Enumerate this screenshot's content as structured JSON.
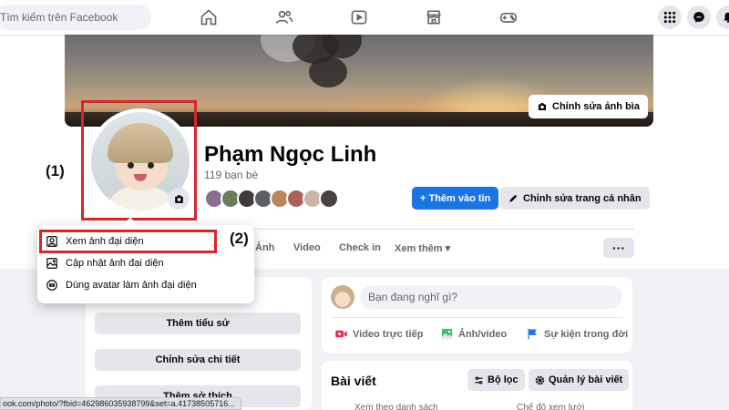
{
  "search": {
    "placeholder": "Tìm kiếm trên Facebook"
  },
  "nav": {
    "icons": [
      "home-icon",
      "friends-icon",
      "watch-icon",
      "marketplace-icon",
      "gaming-icon"
    ],
    "right_icons": [
      "menu-grid-icon",
      "messenger-icon",
      "bell-icon"
    ]
  },
  "cover": {
    "edit_label": "Chỉnh sửa ảnh bìa"
  },
  "profile": {
    "name": "Phạm Ngọc Linh",
    "friends_count": "119 bạn bè",
    "add_story_label": "+ Thêm vào tin",
    "edit_profile_label": "Chỉnh sửa trang cá nhân"
  },
  "annotations": {
    "label_1": "(1)",
    "label_2": "(2)",
    "highlight_color": "#d9262c"
  },
  "tabs": {
    "photos_partial": "Ảnh",
    "video": "Video",
    "checkin": "Check in",
    "more": "Xem thêm ▾",
    "more_button": "···"
  },
  "avatar_menu": {
    "items": [
      {
        "label": "Xem ảnh đại diện",
        "icon": "portrait-icon"
      },
      {
        "label": "Cập nhật ảnh đại diện",
        "icon": "image-icon"
      },
      {
        "label": "Dùng avatar làm ảnh đại diện",
        "icon": "avatar-icon"
      }
    ]
  },
  "intro": {
    "buttons": [
      "Thêm tiểu sử",
      "Chỉnh sửa chi tiết",
      "Thêm sở thích"
    ]
  },
  "composer": {
    "placeholder": "Bạn đang nghĩ gì?",
    "actions": [
      "Video trực tiếp",
      "Ảnh/video",
      "Sự kiện trong đời"
    ]
  },
  "posts": {
    "title": "Bài viết",
    "filter_label": "Bộ lọc",
    "manage_label": "Quản lý bài viết",
    "list_view_partial": "Xem theo danh sách",
    "grid_view_partial": "Chế độ xem lưới"
  },
  "status_url": "ook.com/photo/?fbid=462986035938799&set=a.41738505716...",
  "colors": {
    "brand_blue": "#1b74e4",
    "page_bg": "#f0f2f5"
  }
}
